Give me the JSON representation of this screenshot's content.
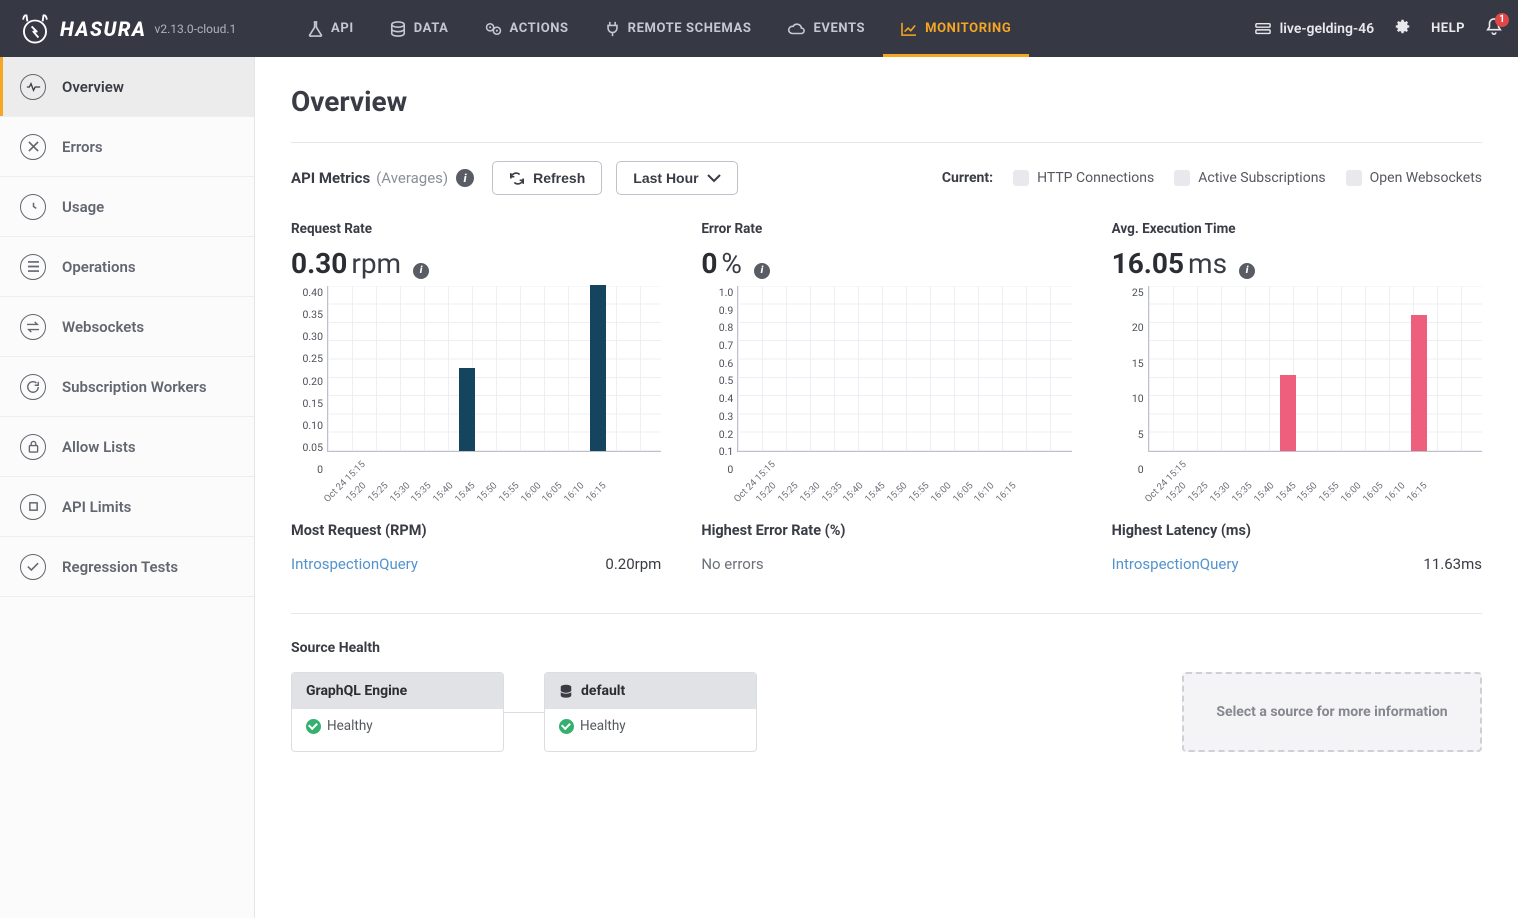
{
  "header": {
    "brand": "HASURA",
    "version": "v2.13.0-cloud.1",
    "nav": [
      "API",
      "DATA",
      "ACTIONS",
      "REMOTE SCHEMAS",
      "EVENTS",
      "MONITORING"
    ],
    "project": "live-gelding-46",
    "help": "HELP",
    "notif_count": "1"
  },
  "sidebar": {
    "items": [
      "Overview",
      "Errors",
      "Usage",
      "Operations",
      "Websockets",
      "Subscription Workers",
      "Allow Lists",
      "API Limits",
      "Regression Tests"
    ]
  },
  "page": {
    "title": "Overview",
    "api_label": "API Metrics",
    "api_sub": "(Averages)",
    "refresh": "Refresh",
    "range": "Last Hour",
    "current": "Current:",
    "cur_http": "HTTP Connections",
    "cur_sub": "Active Subscriptions",
    "cur_ws": "Open Websockets"
  },
  "metrics": {
    "req": {
      "title": "Request Rate",
      "value": "0.30",
      "unit": "rpm"
    },
    "err": {
      "title": "Error Rate",
      "value": "0",
      "unit": "%"
    },
    "lat": {
      "title": "Avg. Execution Time",
      "value": "16.05",
      "unit": "ms"
    }
  },
  "below": {
    "req_title": "Most Request (RPM)",
    "req_link": "IntrospectionQuery",
    "req_val": "0.20rpm",
    "err_title": "Highest Error Rate (%)",
    "err_text": "No errors",
    "lat_title": "Highest Latency (ms)",
    "lat_link": "IntrospectionQuery",
    "lat_val": "11.63ms"
  },
  "source_health": {
    "title": "Source Health",
    "engine": "GraphQL Engine",
    "engine_status": "Healthy",
    "db": "default",
    "db_status": "Healthy",
    "placeholder": "Select a source for more information"
  },
  "chart_data": [
    {
      "type": "bar",
      "title": "Request Rate",
      "ylabel": "rpm",
      "ylim": [
        0,
        0.4
      ],
      "yticks": [
        "0.40",
        "0.35",
        "0.30",
        "0.25",
        "0.20",
        "0.15",
        "0.10",
        "0.05",
        "0"
      ],
      "categories": [
        "Oct 24 15:15",
        "15:20",
        "15:25",
        "15:30",
        "15:35",
        "15:40",
        "15:45",
        "15:50",
        "15:55",
        "16:00",
        "16:05",
        "16:10",
        "16:15"
      ],
      "values": [
        0,
        0,
        0,
        0,
        0,
        0,
        0.2,
        0,
        0,
        0,
        0,
        0,
        0.4
      ],
      "color": "#15445f"
    },
    {
      "type": "bar",
      "title": "Error Rate",
      "ylabel": "%",
      "ylim": [
        0,
        1.0
      ],
      "yticks": [
        "1.0",
        "0.9",
        "0.8",
        "0.7",
        "0.6",
        "0.5",
        "0.4",
        "0.3",
        "0.2",
        "0.1",
        "0"
      ],
      "categories": [
        "Oct 24 15:15",
        "15:20",
        "15:25",
        "15:30",
        "15:35",
        "15:40",
        "15:45",
        "15:50",
        "15:55",
        "16:00",
        "16:05",
        "16:10",
        "16:15"
      ],
      "values": [
        0,
        0,
        0,
        0,
        0,
        0,
        0,
        0,
        0,
        0,
        0,
        0,
        0
      ],
      "color": "#15445f"
    },
    {
      "type": "bar",
      "title": "Avg. Execution Time",
      "ylabel": "ms",
      "ylim": [
        0,
        25
      ],
      "yticks": [
        "25",
        "20",
        "15",
        "10",
        "5",
        "0"
      ],
      "categories": [
        "Oct 24 15:15",
        "15:20",
        "15:25",
        "15:30",
        "15:35",
        "15:40",
        "15:45",
        "15:50",
        "15:55",
        "16:00",
        "16:05",
        "16:10",
        "16:15"
      ],
      "values": [
        0,
        0,
        0,
        0,
        0,
        0,
        11.5,
        0,
        0,
        0,
        0,
        0,
        20.5
      ],
      "color": "#ed5f7d"
    }
  ]
}
